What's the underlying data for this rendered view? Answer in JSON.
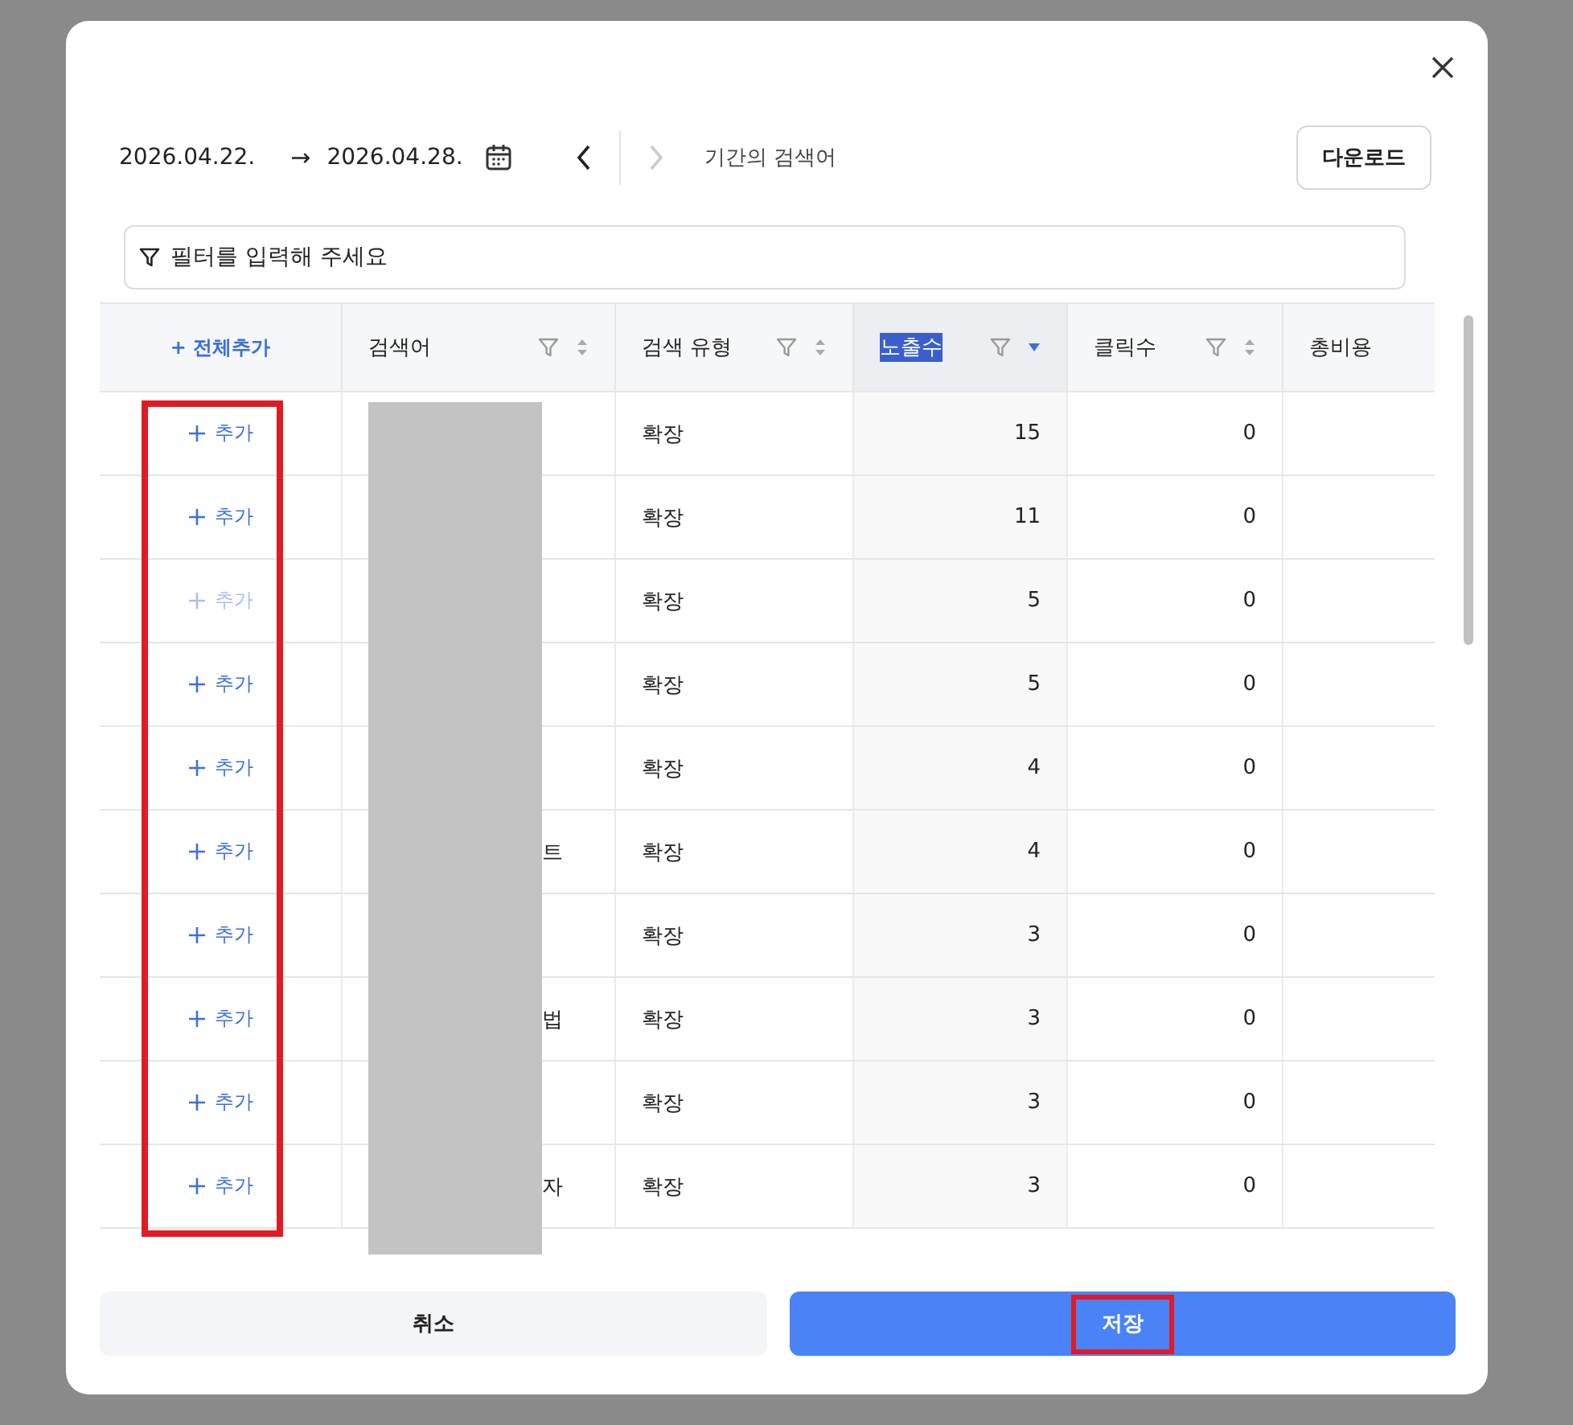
{
  "toolbar": {
    "start_date": "2026.04.22.",
    "arrow": "→",
    "end_date": "2026.04.28.",
    "prev_disabled": false,
    "next_disabled": true,
    "caption": "기간의 검색어",
    "download": "다운로드"
  },
  "filter": {
    "placeholder": "필터를 입력해 주세요"
  },
  "table": {
    "add_all": "+ 전체추가",
    "add_column_highlighted": true,
    "columns": [
      {
        "label": "검색어",
        "sorted": false,
        "text_selected": false
      },
      {
        "label": "검색 유형",
        "sorted": false,
        "text_selected": false
      },
      {
        "label": "노출수",
        "sorted": true,
        "text_selected": true
      },
      {
        "label": "클릭수",
        "sorted": false,
        "text_selected": false
      },
      {
        "label": "총비용",
        "sorted": false,
        "text_selected": false
      }
    ],
    "rows": [
      {
        "add": "추가",
        "disabled": false,
        "keyword": "",
        "type": "확장",
        "impressions": "15",
        "clicks": "0"
      },
      {
        "add": "추가",
        "disabled": false,
        "keyword": "",
        "type": "확장",
        "impressions": "11",
        "clicks": "0"
      },
      {
        "add": "추가",
        "disabled": true,
        "keyword": "",
        "type": "확장",
        "impressions": "5",
        "clicks": "0"
      },
      {
        "add": "추가",
        "disabled": false,
        "keyword": "",
        "type": "확장",
        "impressions": "5",
        "clicks": "0"
      },
      {
        "add": "추가",
        "disabled": false,
        "keyword": "",
        "type": "확장",
        "impressions": "4",
        "clicks": "0"
      },
      {
        "add": "추가",
        "disabled": false,
        "keyword": "트",
        "type": "확장",
        "impressions": "4",
        "clicks": "0"
      },
      {
        "add": "추가",
        "disabled": false,
        "keyword": "",
        "type": "확장",
        "impressions": "3",
        "clicks": "0"
      },
      {
        "add": "추가",
        "disabled": false,
        "keyword": "법",
        "type": "확장",
        "impressions": "3",
        "clicks": "0"
      },
      {
        "add": "추가",
        "disabled": false,
        "keyword": "",
        "type": "확장",
        "impressions": "3",
        "clicks": "0"
      },
      {
        "add": "추가",
        "disabled": false,
        "keyword": "자",
        "type": "확장",
        "impressions": "3",
        "clicks": "0"
      }
    ]
  },
  "footer": {
    "cancel": "취소",
    "save": "저장",
    "save_highlighted": true
  }
}
